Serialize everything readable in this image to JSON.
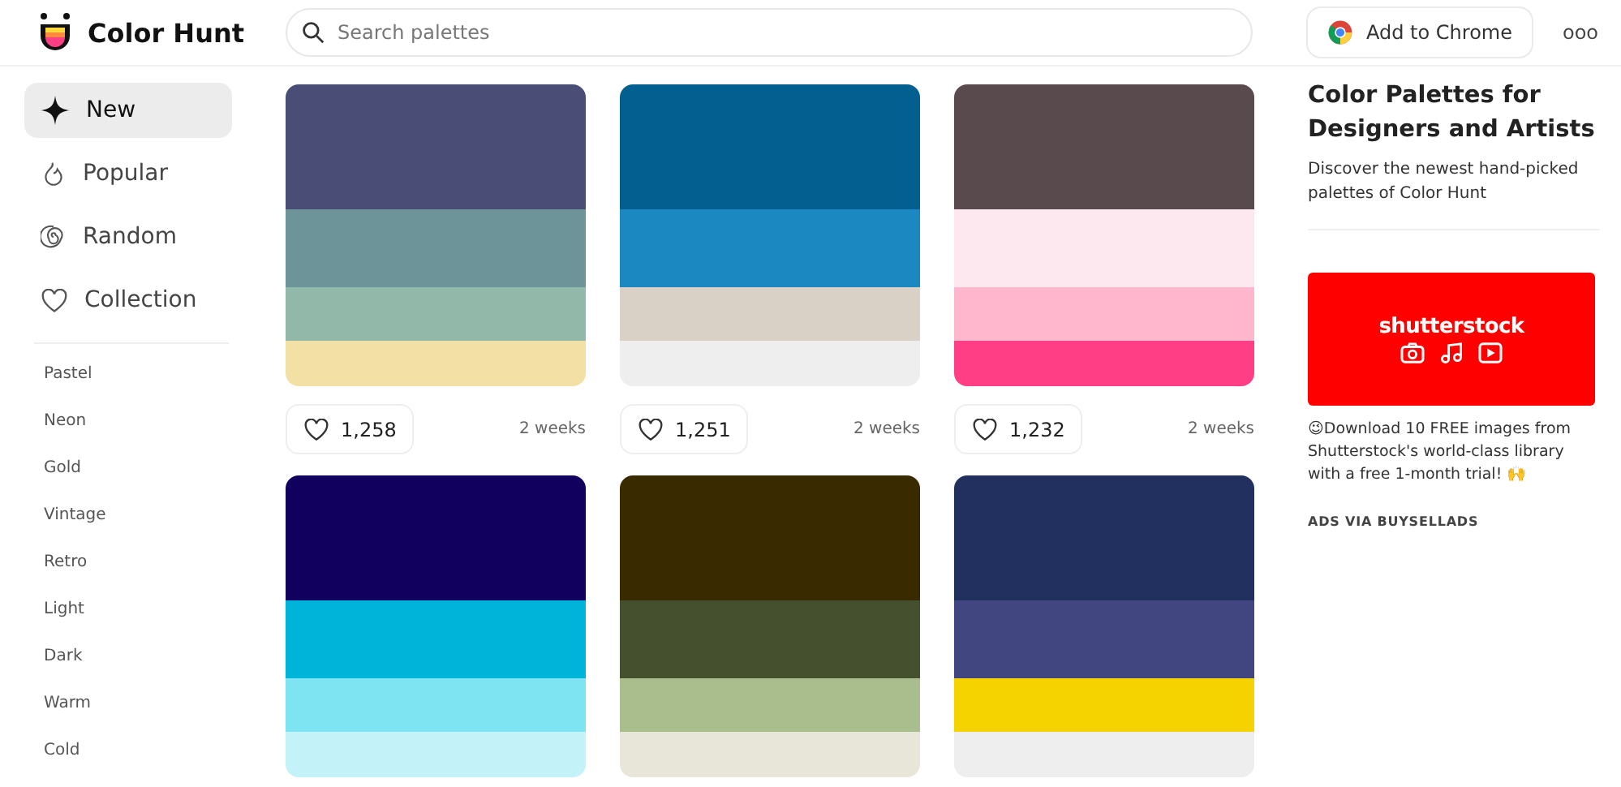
{
  "brand": {
    "name": "Color Hunt"
  },
  "search": {
    "placeholder": "Search palettes"
  },
  "header_actions": {
    "extension_button": "Add to Chrome",
    "more": "ooo"
  },
  "nav": [
    {
      "label": "New",
      "kind": "sparkle",
      "selected": true
    },
    {
      "label": "Popular",
      "kind": "flame",
      "selected": false
    },
    {
      "label": "Random",
      "kind": "spiral",
      "selected": false
    },
    {
      "label": "Collection",
      "kind": "heart",
      "selected": false
    }
  ],
  "tags": [
    "Pastel",
    "Neon",
    "Gold",
    "Vintage",
    "Retro",
    "Light",
    "Dark",
    "Warm",
    "Cold"
  ],
  "palettes": [
    {
      "swatches": [
        {
          "color": "#4a4e76"
        },
        {
          "color": "#6c9499"
        },
        {
          "color": "#92b8aa"
        },
        {
          "color": "#f3e0a5"
        }
      ],
      "likes": "1,258",
      "age": "2 weeks"
    },
    {
      "swatches": [
        {
          "color": "#025f8f"
        },
        {
          "color": "#1c88c1"
        },
        {
          "color": "#d9d1c6"
        },
        {
          "color": "#eeeeee"
        }
      ],
      "likes": "1,251",
      "age": "2 weeks"
    },
    {
      "swatches": [
        {
          "color": "#594a4e"
        },
        {
          "color": "#fee8ef"
        },
        {
          "color": "#ffb7ce"
        },
        {
          "color": "#ff3e86"
        }
      ],
      "likes": "1,232",
      "age": "2 weeks"
    },
    {
      "swatches": [
        {
          "color": "#12005e"
        },
        {
          "color": "#00b4d9"
        },
        {
          "color": "#7ee4f2"
        },
        {
          "color": "#c4f2f9"
        }
      ]
    },
    {
      "swatches": [
        {
          "color": "#3a2a00"
        },
        {
          "color": "#45512e"
        },
        {
          "color": "#a9bd8d"
        },
        {
          "color": "#e8e6d8"
        }
      ]
    },
    {
      "swatches": [
        {
          "color": "#22305f"
        },
        {
          "color": "#414580"
        },
        {
          "color": "#f5d300"
        },
        {
          "color": "#eeeeee"
        }
      ]
    }
  ],
  "aside": {
    "title": "Color Palettes for Designers and Artists",
    "description": "Discover the newest hand-picked palettes of Color Hunt",
    "ad": {
      "logo_text": "shutterstock",
      "text": "😉Download 10 FREE images from Shutterstock's world-class library with a free 1-month trial! 🙌",
      "footer": "ADS VIA BUYSELLADS"
    }
  }
}
